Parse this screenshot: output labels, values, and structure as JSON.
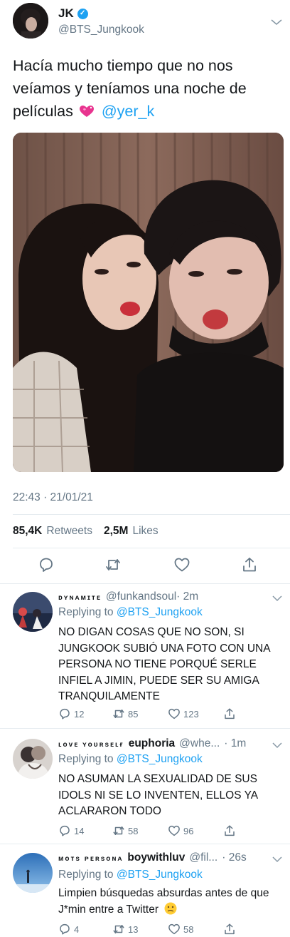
{
  "tweet": {
    "author_name": "JK",
    "author_handle": "@BTS_Jungkook",
    "text_before": "Hacía mucho tiempo que no nos veíamos y teníamos una noche de películas",
    "mention": "@yer_k",
    "timestamp": "22:43 · 21/01/21",
    "retweets_count": "85,4K",
    "retweets_label": "Retweets",
    "likes_count": "2,5M",
    "likes_label": "Likes"
  },
  "replies": [
    {
      "display_name": "ᴅʏɴᴀᴍɪᴛᴇ",
      "handle": "@funkandsoul",
      "time": "· 2m",
      "replying_prefix": "Replying to",
      "replying_to": "@BTS_Jungkook",
      "text": "NO DIGAN COSAS QUE NO SON, SI JUNGKOOK SUBIÓ UNA FOTO CON UNA PERSONA NO TIENE PORQUÉ SERLE INFIEL A JIMIN, PUEDE SER SU AMIGA TRANQUILAMENTE",
      "replies_count": "12",
      "retweets_count": "85",
      "likes_count": "123"
    },
    {
      "display_name": "ʟᴏᴠᴇ ʏᴏᴜʀsᴇʟғ",
      "display_name_bold": "euphoria",
      "handle": "@whe...",
      "time": "· 1m",
      "replying_prefix": "Replying to",
      "replying_to": "@BTS_Jungkook",
      "text": "NO ASUMAN LA SEXUALIDAD DE SUS IDOLS NI SE LO INVENTEN, ELLOS YA ACLARARON TODO",
      "replies_count": "14",
      "retweets_count": "58",
      "likes_count": "96"
    },
    {
      "display_name": "ᴍᴏᴛs ᴘᴇʀsᴏɴᴀ",
      "display_name_bold": "boywithluv",
      "handle": "@fil...",
      "time": "· 26s",
      "replying_prefix": "Replying to",
      "replying_to": "@BTS_Jungkook",
      "text": "Limpien búsquedas absurdas antes de que J*min entre a Twitter",
      "replies_count": "4",
      "retweets_count": "13",
      "likes_count": "58"
    }
  ],
  "colors": {
    "accent": "#1da1f2",
    "text": "#14171a",
    "secondary": "#657786",
    "divider": "#e6ecf0"
  },
  "icons": [
    "verified-badge-icon",
    "chevron-down-icon",
    "reply-icon",
    "retweet-icon",
    "like-icon",
    "share-icon",
    "sparkling-heart-emoji",
    "confused-face-emoji"
  ]
}
